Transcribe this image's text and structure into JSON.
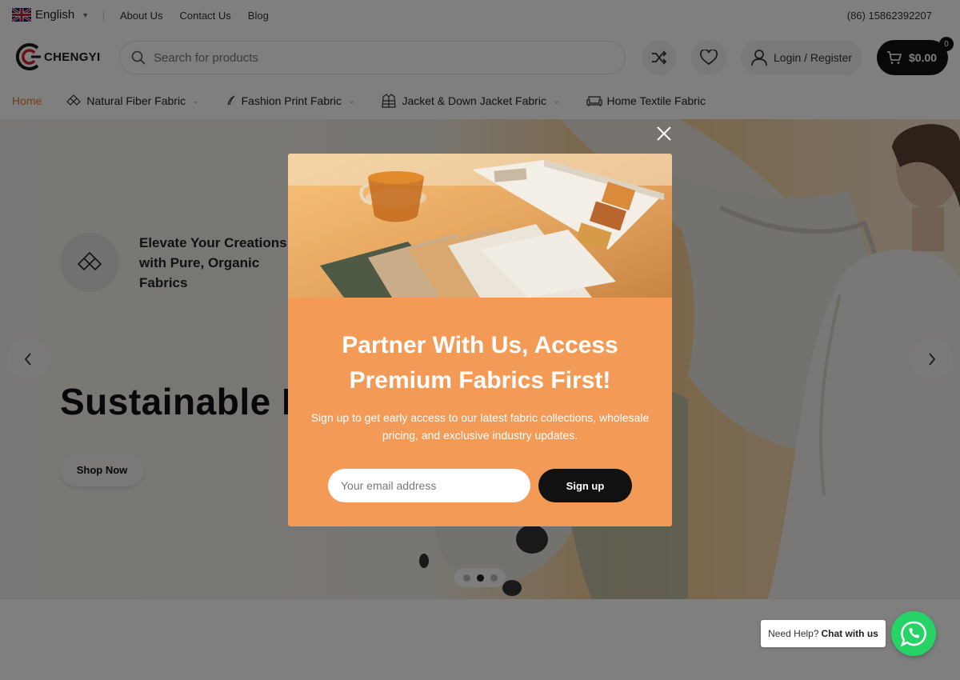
{
  "topbar": {
    "language": "English",
    "links": [
      "About Us",
      "Contact Us",
      "Blog"
    ],
    "phone": "(86) 15862392207"
  },
  "header": {
    "logo_text": "CHENGYI",
    "search_placeholder": "Search for products",
    "login_label": "Login / Register",
    "cart_total": "$0.00",
    "cart_count": "0"
  },
  "nav": {
    "items": [
      {
        "label": "Home",
        "icon": "none",
        "active": true
      },
      {
        "label": "Natural Fiber Fabric",
        "icon": "diamond-pattern-icon"
      },
      {
        "label": "Fashion Print Fabric",
        "icon": "leaf-icon"
      },
      {
        "label": "Jacket & Down Jacket Fabric",
        "icon": "jacket-icon"
      },
      {
        "label": "Home Textile Fabric",
        "icon": "sofa-icon"
      }
    ]
  },
  "hero": {
    "kicker": "Elevate Your Creations with Pure, Organic Fabrics",
    "title": "Sustainable N",
    "button_label": "Shop Now",
    "slides_total": 3,
    "active_slide": 2
  },
  "popup": {
    "title": "Partner With Us, Access Premium Fabrics First!",
    "description": "Sign up to get early access to our latest fabric collections, wholesale pricing, and exclusive industry updates.",
    "email_placeholder": "Your email address",
    "signup_label": "Sign up"
  },
  "chat": {
    "prefix": "Need Help?",
    "label": "Chat with us"
  },
  "colors": {
    "accent": "#f39a57",
    "nav_active": "#e0803a",
    "whatsapp": "#25d366"
  }
}
